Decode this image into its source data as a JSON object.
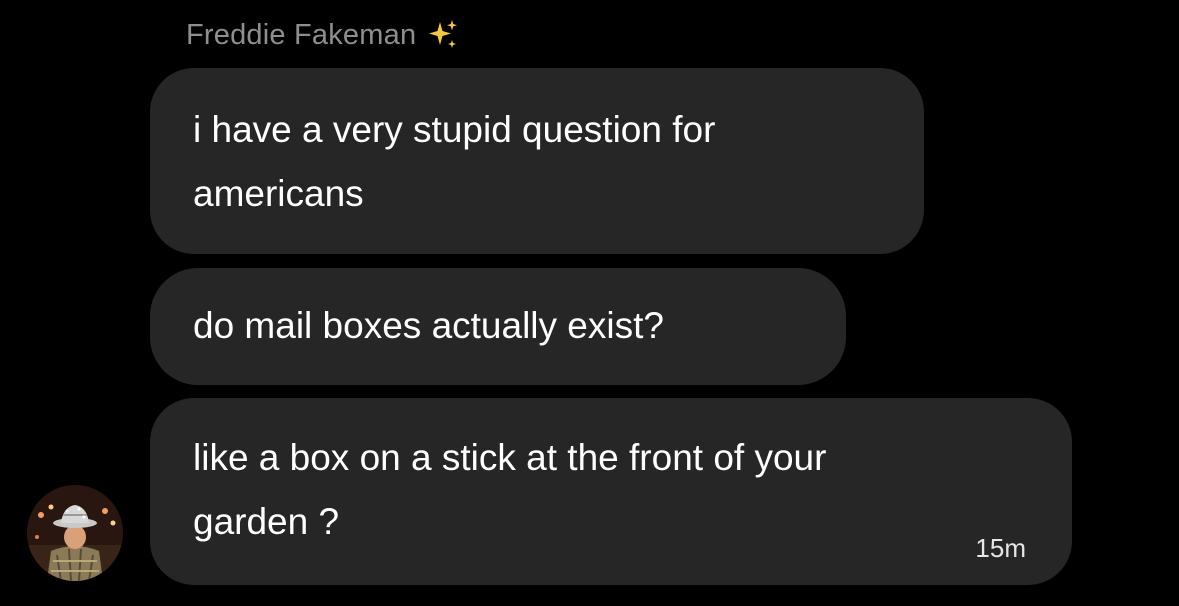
{
  "conversation": {
    "sender": {
      "name": "Freddie Fakeman",
      "badge_icon": "sparkles-icon"
    },
    "messages": [
      {
        "text": "i have a very stupid question for\namericans"
      },
      {
        "text": "do mail boxes actually exist?"
      },
      {
        "text": "like a box on a stick at the front of your\ngarden ?",
        "time": "15m"
      }
    ],
    "avatar": {
      "icon": "avatar-photo"
    }
  },
  "colors": {
    "background": "#000000",
    "bubble": "#262626",
    "sender_name": "#8e8e8e",
    "text": "#ffffff",
    "sparkle": "#f5c842"
  }
}
